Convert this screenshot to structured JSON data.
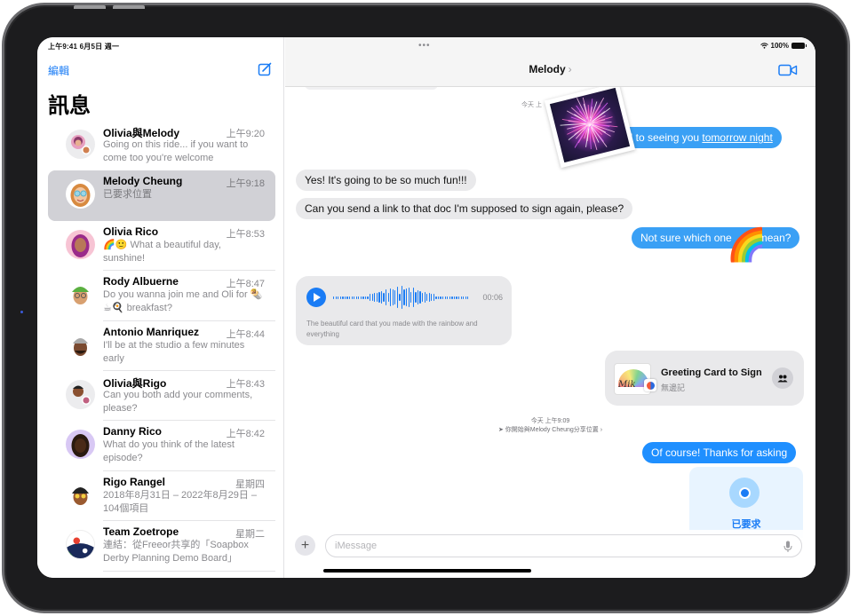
{
  "status_bar": {
    "time_date": "上午9:41  6月5日 週一",
    "multitask_dots": "•••",
    "battery": "100%"
  },
  "sidebar": {
    "edit_label": "編輯",
    "compose_icon": "compose-icon",
    "title": "訊息",
    "conversations": [
      {
        "name": "Olivia與Melody",
        "time": "上午9:20",
        "preview": "Going on this ride... if you want to come too you're welcome",
        "avatar": "group-avatar",
        "selected": false
      },
      {
        "name": "Melody Cheung",
        "time": "上午9:18",
        "preview": "已要求位置",
        "avatar": "memoji-avatar",
        "selected": true
      },
      {
        "name": "Olivia Rico",
        "time": "上午8:53",
        "preview": "🌈🙂 What a beautiful day, sunshine!",
        "avatar": "memoji-avatar",
        "selected": false
      },
      {
        "name": "Rody Albuerne",
        "time": "上午8:47",
        "preview": "Do you wanna join me and Oli for 🌯☕🍳 breakfast?",
        "avatar": "memoji-avatar",
        "selected": false
      },
      {
        "name": "Antonio Manriquez",
        "time": "上午8:44",
        "preview": "I'll be at the studio a few minutes early",
        "avatar": "memoji-avatar",
        "selected": false
      },
      {
        "name": "Olivia與Rigo",
        "time": "上午8:43",
        "preview": "Can you both add your comments, please?",
        "avatar": "group-avatar",
        "selected": false
      },
      {
        "name": "Danny Rico",
        "time": "上午8:42",
        "preview": "What do you think of the latest episode?",
        "avatar": "memoji-avatar",
        "selected": false
      },
      {
        "name": "Rigo Rangel",
        "time": "星期四",
        "preview": "2018年8月31日 – 2022年8月29日 – 104個項目",
        "avatar": "memoji-avatar",
        "selected": false
      },
      {
        "name": "Team Zoetrope",
        "time": "星期二",
        "preview": "連結：從Freeor共享的「Soapbox Derby Planning Demo Board」",
        "avatar": "group-photo-avatar",
        "selected": false
      }
    ]
  },
  "chat": {
    "contact_name": "Melody",
    "chevron": "›",
    "video_icon": "video-camera-icon",
    "timestamp_top": "今天 上",
    "messages": [
      {
        "dir": "out",
        "text_plain": "ard to seeing you ",
        "text_link": "tomorrow night"
      },
      {
        "dir": "in",
        "text": "Yes! It's going to be so much fun!!!"
      },
      {
        "dir": "in",
        "text": "Can you send a link to that doc I'm supposed to sign again, please?"
      },
      {
        "dir": "out",
        "text_a": "Not sure which one",
        "text_b": "mean?"
      }
    ],
    "audio_message": {
      "duration": "00:06",
      "transcript": "The beautiful card that you made with the rainbow and everything"
    },
    "shared_doc": {
      "title": "Greeting Card to Sign",
      "subtitle": "無邊記"
    },
    "location_note": {
      "timestamp": "今天 上午9:09",
      "text": "你開始與Melody Cheung分享位置 ›"
    },
    "reply": "Of course! Thanks for asking",
    "location_request": {
      "label": "已要求"
    },
    "stickers": [
      "fireworks-photo-sticker",
      "rainbow-sticker"
    ]
  },
  "composer": {
    "placeholder": "iMessage",
    "value": "",
    "plus_label": "+"
  }
}
